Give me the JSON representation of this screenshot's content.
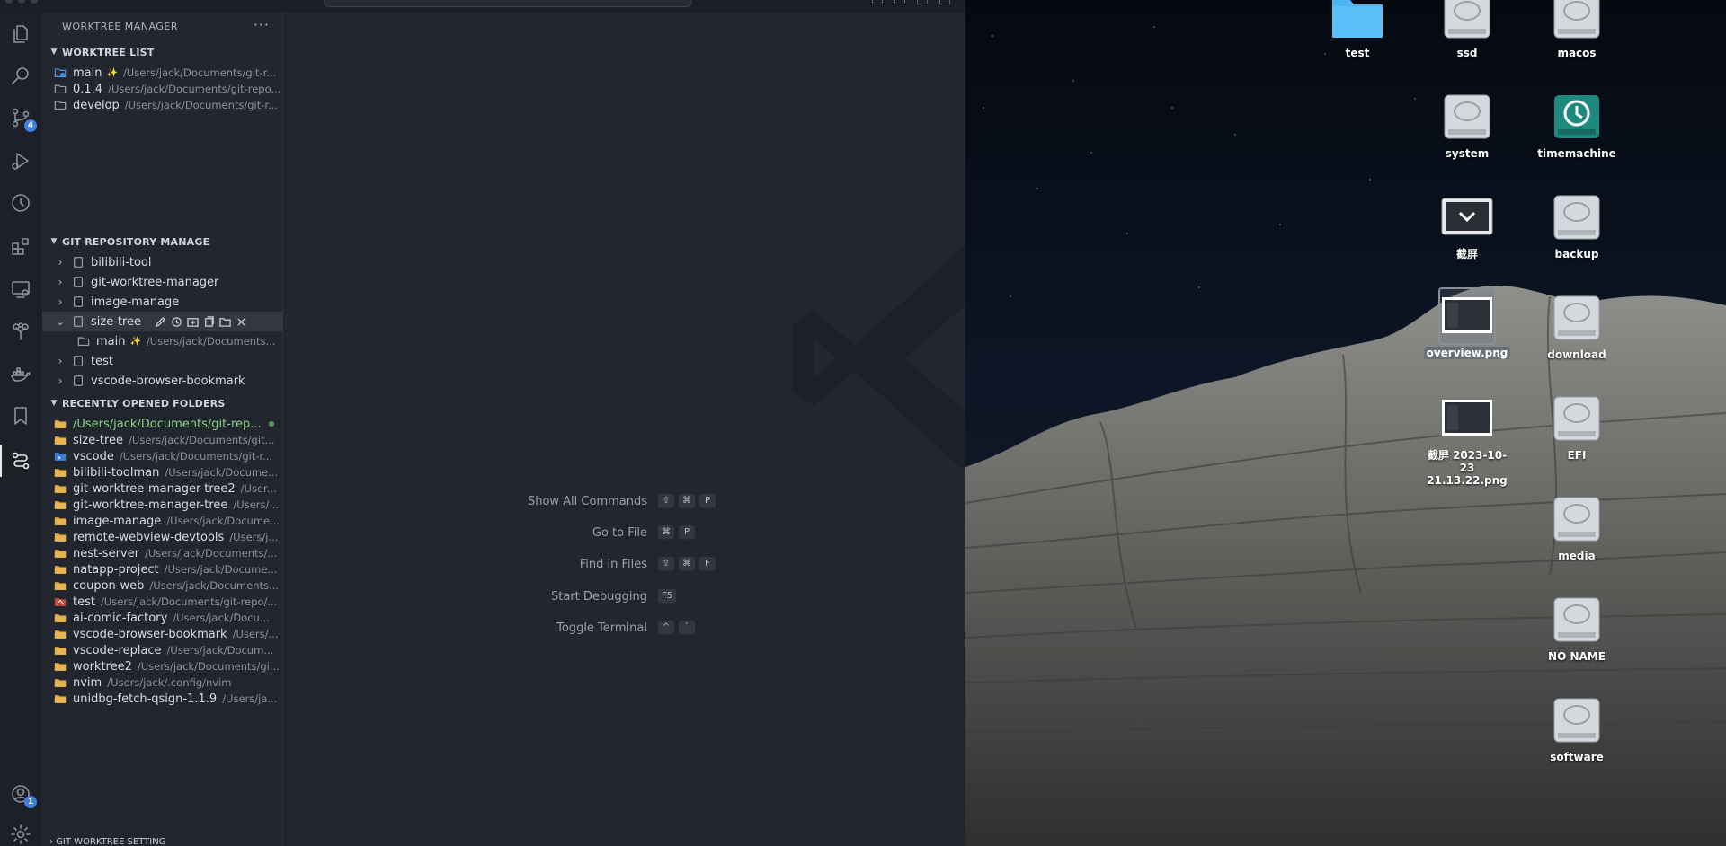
{
  "sidebar": {
    "title": "WORKTREE MANAGER",
    "more": "···",
    "worktree_list": {
      "header": "WORKTREE LIST",
      "items": [
        {
          "name": "main",
          "path": "/Users/jack/Documents/git-r...",
          "current": true
        },
        {
          "name": "0.1.4",
          "path": "/Users/jack/Documents/git-repo...",
          "current": false
        },
        {
          "name": "develop",
          "path": "/Users/jack/Documents/git-r...",
          "current": false
        }
      ]
    },
    "git_repository_manage": {
      "header": "GIT REPOSITORY MANAGE",
      "items": [
        {
          "name": "bilibili-tool"
        },
        {
          "name": "git-worktree-manager"
        },
        {
          "name": "image-manage"
        },
        {
          "name": "size-tree"
        },
        {
          "name": "test"
        },
        {
          "name": "vscode-browser-bookmark"
        }
      ],
      "child": {
        "name": "main",
        "path": "/Users/jack/Documents..."
      }
    },
    "recently_opened_folders": {
      "header": "RECENTLY OPENED FOLDERS",
      "items": [
        {
          "name": "/Users/jack/Documents/git-rep...",
          "path": ""
        },
        {
          "name": "size-tree",
          "path": "/Users/jack/Documents/git..."
        },
        {
          "name": "vscode",
          "path": "/Users/jack/Documents/git-r..."
        },
        {
          "name": "bilibili-toolman",
          "path": "/Users/jack/Docume..."
        },
        {
          "name": "git-worktree-manager-tree2",
          "path": "/User..."
        },
        {
          "name": "git-worktree-manager-tree",
          "path": "/Users/..."
        },
        {
          "name": "image-manage",
          "path": "/Users/jack/Docume..."
        },
        {
          "name": "remote-webview-devtools",
          "path": "/Users/j..."
        },
        {
          "name": "nest-server",
          "path": "/Users/jack/Documents/..."
        },
        {
          "name": "natapp-project",
          "path": "/Users/jack/Docume..."
        },
        {
          "name": "coupon-web",
          "path": "/Users/jack/Documents..."
        },
        {
          "name": "test",
          "path": "/Users/jack/Documents/git-repo/..."
        },
        {
          "name": "ai-comic-factory",
          "path": "/Users/jack/Docu..."
        },
        {
          "name": "vscode-browser-bookmark",
          "path": "/Users/..."
        },
        {
          "name": "vscode-replace",
          "path": "/Users/jack/Docum..."
        },
        {
          "name": "worktree2",
          "path": "/Users/jack/Documents/gi..."
        },
        {
          "name": "nvim",
          "path": "/Users/jack/.config/nvim"
        },
        {
          "name": "unidbg-fetch-qsign-1.1.9",
          "path": "/Users/ja..."
        }
      ]
    },
    "bottom_section": "GIT WORKTREE SETTING"
  },
  "activity": {
    "scm_badge": "4",
    "accounts_badge": "1"
  },
  "editor": {
    "shortcuts": [
      {
        "label": "Show All Commands",
        "keys": [
          "⇧",
          "⌘",
          "P"
        ]
      },
      {
        "label": "Go to File",
        "keys": [
          "⌘",
          "P"
        ]
      },
      {
        "label": "Find in Files",
        "keys": [
          "⇧",
          "⌘",
          "F"
        ]
      },
      {
        "label": "Start Debugging",
        "keys": [
          "F5"
        ]
      },
      {
        "label": "Toggle Terminal",
        "keys": [
          "^",
          "`"
        ]
      }
    ]
  },
  "desktop": {
    "icons": [
      {
        "label": "test",
        "kind": "folder-icon"
      },
      {
        "label": "ssd",
        "kind": "disk-icon"
      },
      {
        "label": "macos",
        "kind": "disk-icon"
      },
      {
        "label": "system",
        "kind": "disk-icon"
      },
      {
        "label": "timemachine",
        "kind": "timemachine-icon"
      },
      {
        "label": "截屏",
        "kind": "screenshot-folder-icon"
      },
      {
        "label": "backup",
        "kind": "disk-icon"
      },
      {
        "label": "overview.png",
        "kind": "image-file-icon"
      },
      {
        "label": "download",
        "kind": "disk-icon"
      },
      {
        "label": "截屏 2023-10-23\n21.13.22.png",
        "kind": "image-file-icon"
      },
      {
        "label": "EFI",
        "kind": "disk-icon"
      },
      {
        "label": "media",
        "kind": "disk-icon"
      },
      {
        "label": "NO NAME",
        "kind": "disk-icon"
      },
      {
        "label": "software",
        "kind": "disk-icon"
      }
    ]
  },
  "colors": {
    "editor_bg": "#22262e",
    "activity_bg": "#1d2026",
    "accent_badge": "#3f7fe0",
    "active_folder": "#89d185",
    "folder_icon": "#d9a441"
  }
}
